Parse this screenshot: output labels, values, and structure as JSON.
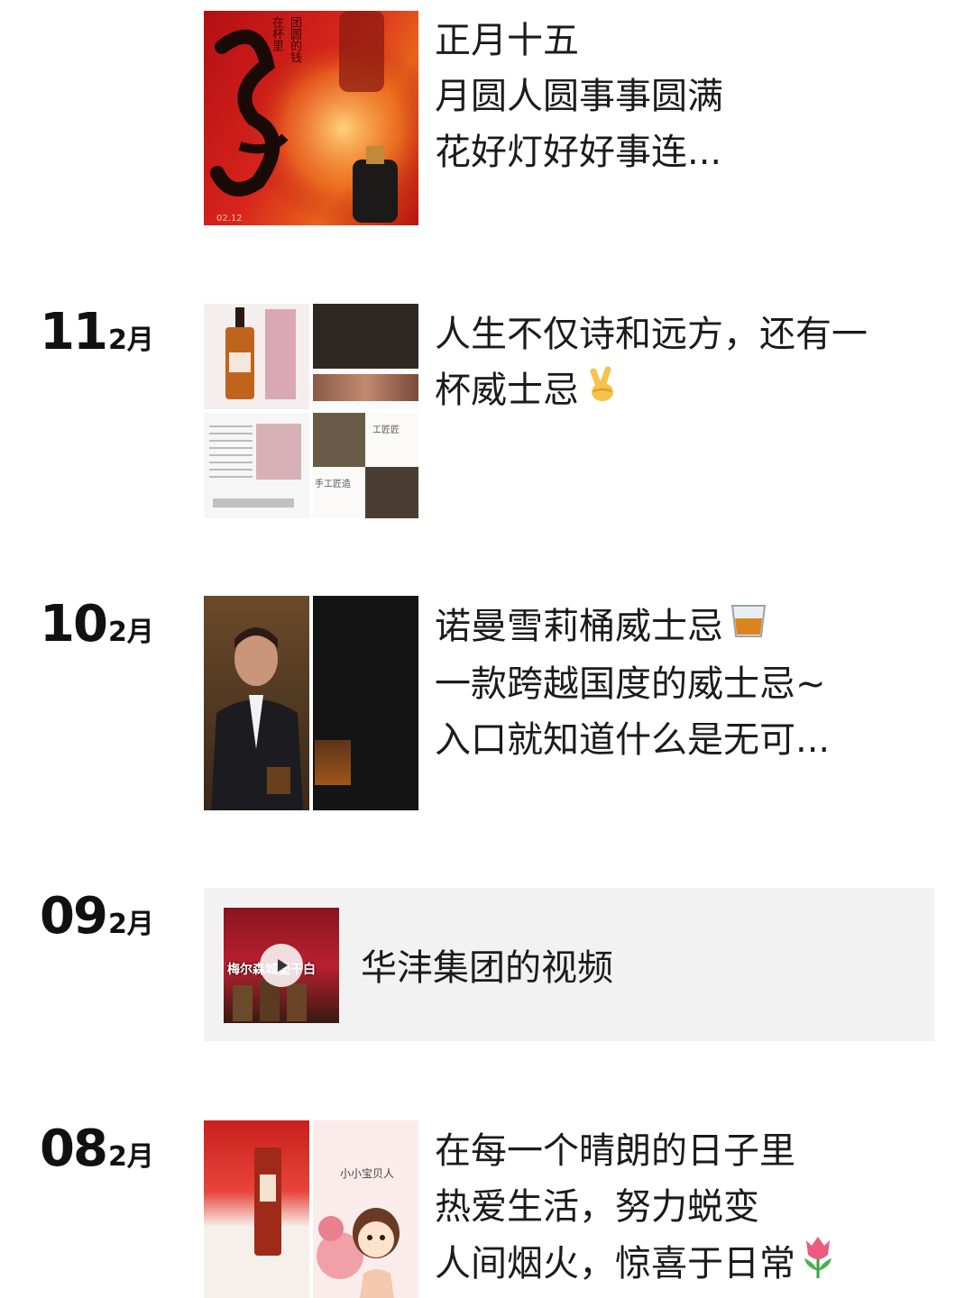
{
  "posts": [
    {
      "lines": [
        "正月十五",
        "月圆人圆事事圆满",
        "花好灯好好事连..."
      ],
      "thumb_text": [
        "团圆的钱",
        "在杯里",
        "02.12"
      ]
    },
    {
      "day": "11",
      "month": "2月",
      "lines": [
        "人生不仅诗和远方，还有一",
        "杯威士忌"
      ],
      "emoji": "victory-hand-icon",
      "thumb_text": [
        "手工匠造",
        "工匠匠"
      ]
    },
    {
      "day": "10",
      "month": "2月",
      "lines": [
        "诺曼雪莉桶威士忌",
        "一款跨越国度的威士忌~",
        "入口就知道什么是无可..."
      ],
      "emoji": "whisky-glass-icon"
    },
    {
      "day": "09",
      "month": "2月",
      "video_title": "华沣集团的视频",
      "thumb_text": "梅尔森城堡干白"
    },
    {
      "day": "08",
      "month": "2月",
      "lines": [
        "在每一个晴朗的日子里",
        "热爱生活，努力蜕变",
        "人间烟火，惊喜于日常"
      ],
      "emoji": "tulip-icon",
      "thumb_text": [
        "小小宝贝人"
      ]
    }
  ],
  "colors": {
    "red": "#c4161c",
    "video_card_bg": "#f2f2f2"
  }
}
